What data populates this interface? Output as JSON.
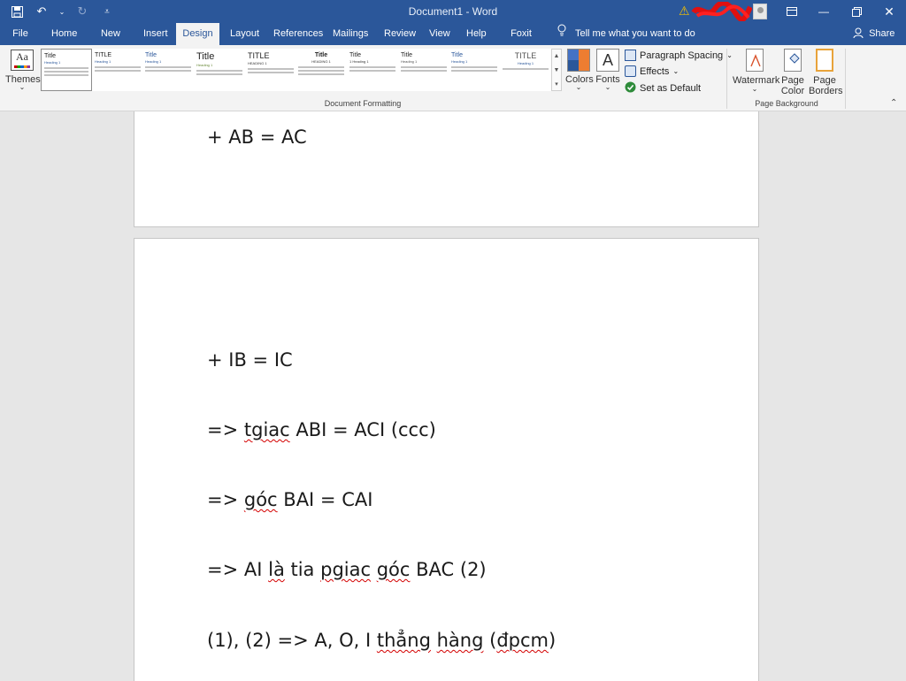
{
  "titlebar": {
    "document_title": "Document1 - Word",
    "qat_icons": [
      "save-icon",
      "undo-icon",
      "redo-icon",
      "customize-qat-icon"
    ],
    "window_buttons": [
      "ribbon-display-options-icon",
      "minimize-icon",
      "restore-icon",
      "close-icon"
    ]
  },
  "tabs": [
    "File",
    "Home",
    "New Tab",
    "Insert",
    "Design",
    "Layout",
    "References",
    "Mailings",
    "Review",
    "View",
    "Help",
    "Foxit PDF"
  ],
  "active_tab": "Design",
  "tell_me": "Tell me what you want to do",
  "share": "Share",
  "ribbon": {
    "themes_label": "Themes",
    "style_gallery": [
      {
        "title": "Title",
        "heading": "Heading 1"
      },
      {
        "title": "TITLE",
        "heading": "Heading 1"
      },
      {
        "title": "Title",
        "heading": "Heading 1"
      },
      {
        "title": "Title",
        "heading": "Heading 1"
      },
      {
        "title": "TITLE",
        "heading": "HEADING 1"
      },
      {
        "title": "Title",
        "heading": "HEADING 1"
      },
      {
        "title": "Title",
        "heading": "1 Heading 1"
      },
      {
        "title": "Title",
        "heading": "Heading 1"
      },
      {
        "title": "Title",
        "heading": "Heading 1"
      },
      {
        "title": "TITLE",
        "heading": "Heading 1"
      }
    ],
    "colors_label": "Colors",
    "fonts_label": "Fonts",
    "paragraph_spacing": "Paragraph Spacing",
    "effects": "Effects",
    "set_as_default": "Set as Default",
    "document_formatting_label": "Document Formatting",
    "watermark": "Watermark",
    "page_color_line1": "Page",
    "page_color_line2": "Color",
    "page_borders_line1": "Page",
    "page_borders_line2": "Borders",
    "page_background_label": "Page Background",
    "accent_color": "#2b579a"
  },
  "document": {
    "page1_lines": [
      "+ AB = AC"
    ],
    "page2": {
      "line1": "+ IB = IC",
      "line2": {
        "a": "=> ",
        "b": "tgiac",
        "c": " ABI = ACI (ccc)"
      },
      "line3": {
        "a": "=> ",
        "b": "góc",
        "c": " BAI = CAI"
      },
      "line4": {
        "a": "=> AI ",
        "b": "là",
        "c": " tia ",
        "d": "pgiac",
        "e": " ",
        "f": "góc",
        "g": " BAC (2)"
      },
      "line5": {
        "a": "(1), (2) => A, O, I ",
        "b": "thẳng",
        "c": " ",
        "d": "hàng",
        "e": " (",
        "f": "đpcm",
        "g": ")"
      }
    }
  }
}
